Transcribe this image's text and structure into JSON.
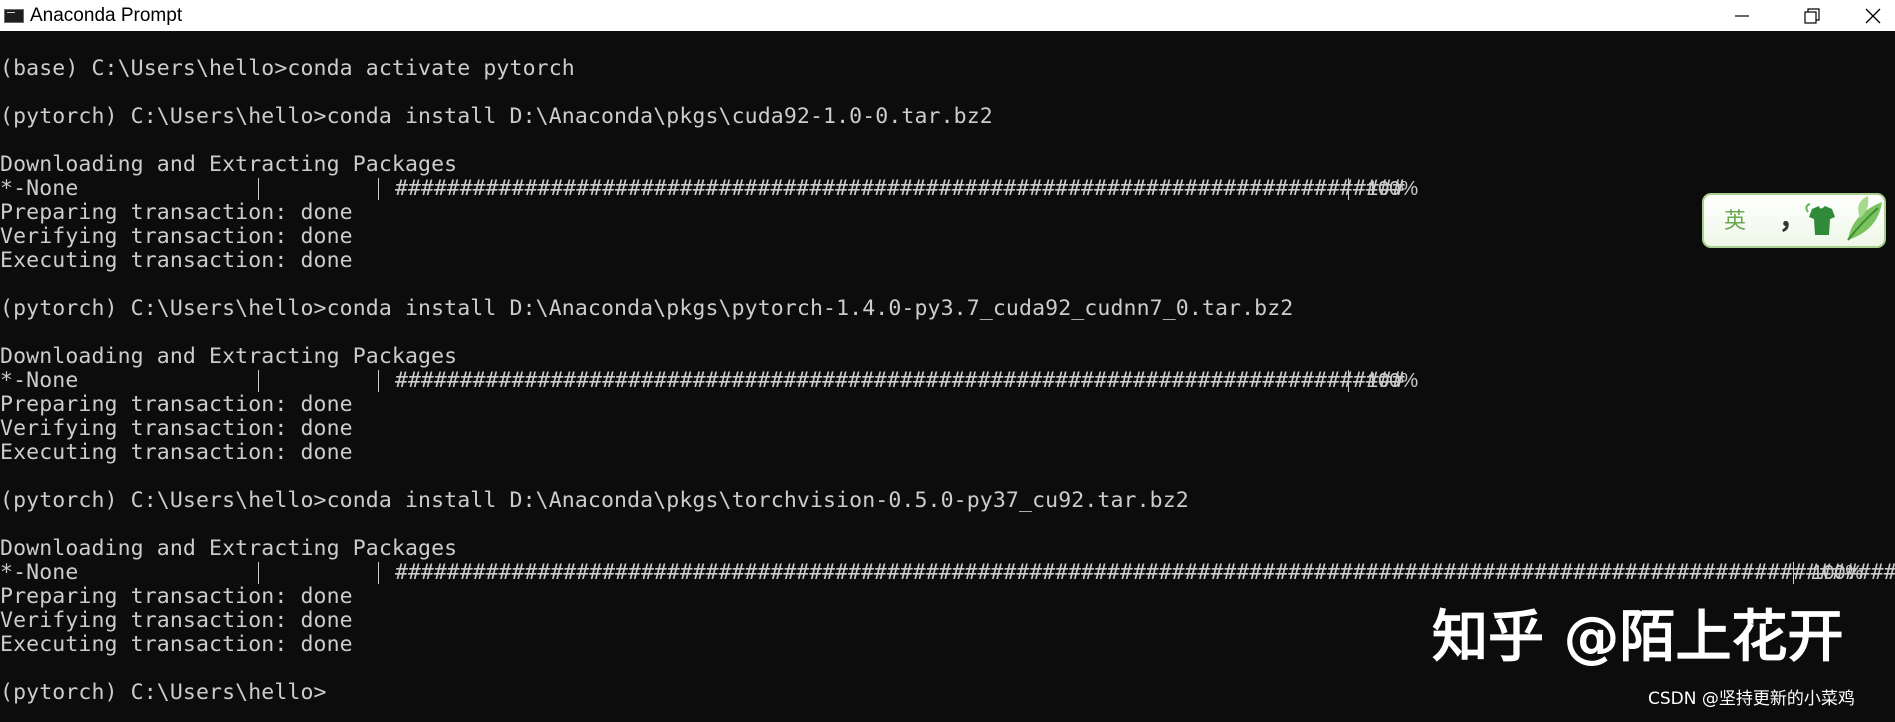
{
  "window": {
    "title": "Anaconda Prompt",
    "icon": "console-icon",
    "controls": [
      "minimize-icon",
      "maximize-icon",
      "close-icon"
    ]
  },
  "console": {
    "lines": [
      "(base) C:\\Users\\hello>conda activate pytorch",
      "",
      "(pytorch) C:\\Users\\hello>conda install D:\\Anaconda\\pkgs\\cuda92-1.0-0.tar.bz2",
      "",
      "Downloading and Extracting Packages",
      "*-None",
      "Preparing transaction: done",
      "Verifying transaction: done",
      "Executing transaction: done",
      "",
      "(pytorch) C:\\Users\\hello>conda install D:\\Anaconda\\pkgs\\pytorch-1.4.0-py3.7_cuda92_cudnn7_0.tar.bz2",
      "",
      "Downloading and Extracting Packages",
      "*-None",
      "Preparing transaction: done",
      "Verifying transaction: done",
      "Executing transaction: done",
      "",
      "(pytorch) C:\\Users\\hello>conda install D:\\Anaconda\\pkgs\\torchvision-0.5.0-py37_cu92.tar.bz2",
      "",
      "Downloading and Extracting Packages",
      "*-None",
      "Preparing transaction: done",
      "Verifying transaction: done",
      "Executing transaction: done",
      "",
      "(pytorch) C:\\Users\\hello>"
    ],
    "progress": [
      {
        "bar": "##############################################################################",
        "percent_label": "100%",
        "value": 1.0
      },
      {
        "bar": "##############################################################################",
        "percent_label": "100%",
        "value": 1.0
      },
      {
        "bar": "#####################################################################################################################",
        "percent_label": "100%",
        "value": 1.0
      }
    ]
  },
  "ime_toolbar": {
    "mode": "英",
    "punct": "，",
    "icons": [
      "shirt-icon",
      "leaf-icon"
    ],
    "accent": "#6aa84f"
  },
  "watermarks": {
    "zhihu": "知乎 @陌上花开",
    "csdn": "CSDN @坚持更新的小菜鸡"
  },
  "colors": {
    "background": "#0c0c0c",
    "text": "#cccccc"
  }
}
